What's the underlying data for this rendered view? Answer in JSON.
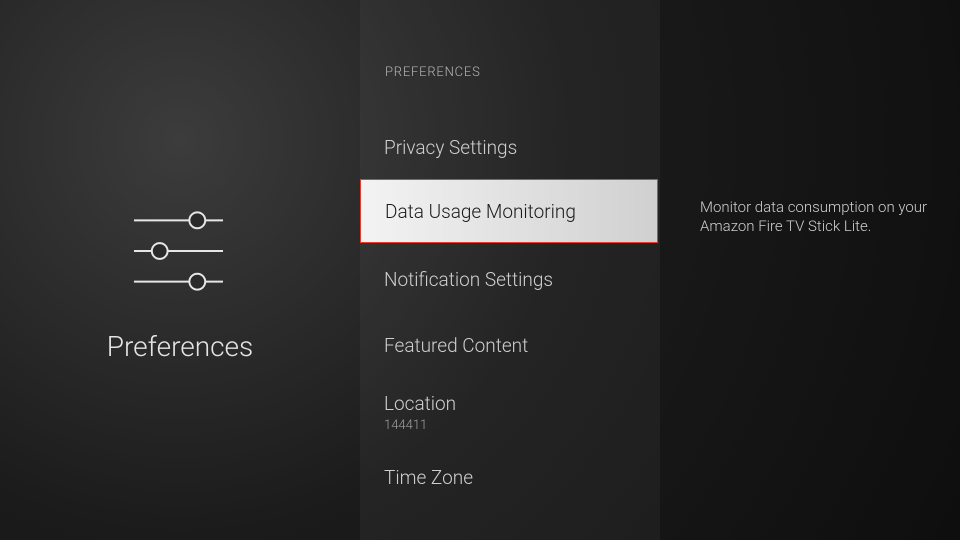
{
  "left": {
    "title": "Preferences",
    "icon": "sliders"
  },
  "column": {
    "header": "PREFERENCES",
    "items": [
      {
        "label": "Privacy Settings",
        "sub": ""
      },
      {
        "label": "Data Usage Monitoring",
        "sub": "",
        "selected": true
      },
      {
        "label": "Notification Settings",
        "sub": ""
      },
      {
        "label": "Featured Content",
        "sub": ""
      },
      {
        "label": "Location",
        "sub": "144411"
      },
      {
        "label": "Time Zone",
        "sub": ""
      }
    ]
  },
  "description": "Monitor data consumption on your Amazon Fire TV Stick Lite."
}
